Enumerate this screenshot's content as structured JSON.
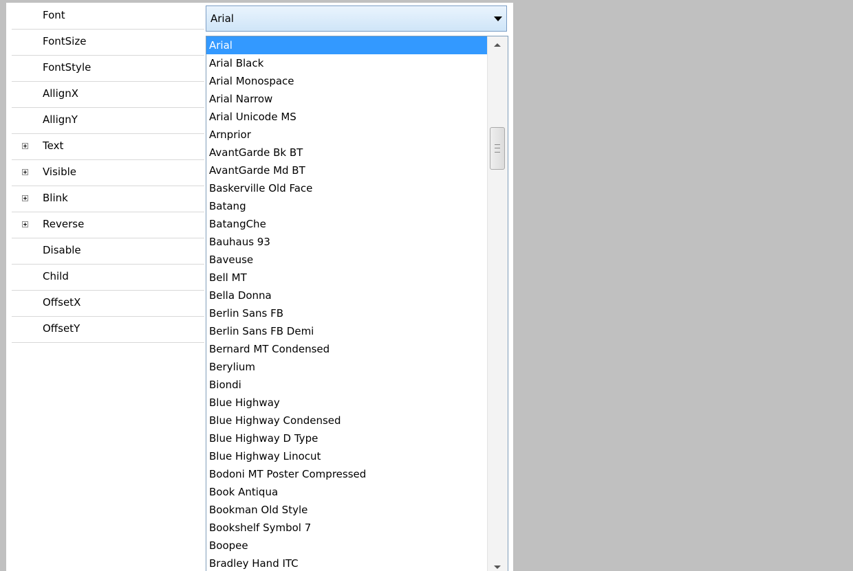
{
  "property_grid": {
    "rows": [
      {
        "label": "Font",
        "expandable": false
      },
      {
        "label": "FontSize",
        "expandable": false
      },
      {
        "label": "FontStyle",
        "expandable": false
      },
      {
        "label": "AllignX",
        "expandable": false
      },
      {
        "label": "AllignY",
        "expandable": false
      },
      {
        "label": "Text",
        "expandable": true
      },
      {
        "label": "Visible",
        "expandable": true
      },
      {
        "label": "Blink",
        "expandable": true
      },
      {
        "label": "Reverse",
        "expandable": true
      },
      {
        "label": "Disable",
        "expandable": false
      },
      {
        "label": "Child",
        "expandable": false
      },
      {
        "label": "OffsetX",
        "expandable": false
      },
      {
        "label": "OffsetY",
        "expandable": false
      }
    ]
  },
  "font_combo": {
    "value": "Arial",
    "icon": "chevron-down-icon"
  },
  "font_dropdown": {
    "selected": "Arial",
    "options": [
      "Arial",
      "Arial Black",
      "Arial Monospace",
      "Arial Narrow",
      "Arial Unicode MS",
      "Arnprior",
      "AvantGarde Bk BT",
      "AvantGarde Md BT",
      "Baskerville Old Face",
      "Batang",
      "BatangChe",
      "Bauhaus 93",
      "Baveuse",
      "Bell MT",
      "Bella Donna",
      "Berlin Sans FB",
      "Berlin Sans FB Demi",
      "Bernard MT Condensed",
      "Berylium",
      "Biondi",
      "Blue Highway",
      "Blue Highway Condensed",
      "Blue Highway D Type",
      "Blue Highway Linocut",
      "Bodoni MT Poster Compressed",
      "Book Antiqua",
      "Bookman Old Style",
      "Bookshelf Symbol 7",
      "Boopee",
      "Bradley Hand ITC"
    ]
  },
  "colors": {
    "selection": "#3399ff",
    "background_gray": "#c0c0c0"
  }
}
